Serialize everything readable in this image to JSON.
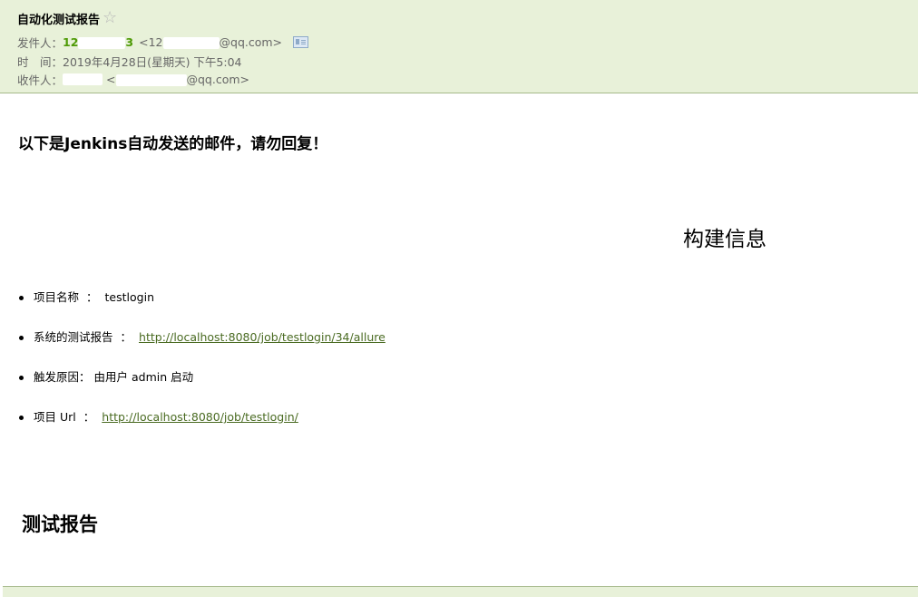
{
  "header": {
    "subject": "自动化测试报告",
    "star_icon": "star-outline-icon",
    "from_label": "发件人：",
    "from_name": "12",
    "from_name_tail": "3",
    "from_addr_open": "<12",
    "from_addr_domain": "@qq.com>",
    "contact_card_icon": "contact-card-icon",
    "time_label": "时　间：",
    "time_value": "2019年4月28日(星期天) 下午5:04",
    "to_label": "收件人：",
    "to_addr_open": "<",
    "to_addr_domain": "@qq.com>"
  },
  "body": {
    "intro": "以下是Jenkins自动发送的邮件，请勿回复！",
    "build_title": "构建信息",
    "items": [
      {
        "label": "项目名称",
        "sep": "：",
        "value": "testlogin"
      },
      {
        "label": "系统的测试报告",
        "sep": "：",
        "link": "http://localhost:8080/job/testlogin/34/allure"
      },
      {
        "label": "触发原因：",
        "value": "由用户 admin 启动"
      },
      {
        "label": "项目 Url",
        "sep": "：",
        "link": "http://localhost:8080/job/testlogin/"
      }
    ],
    "report_title": "测试报告"
  },
  "colors": {
    "header_bg": "#e8f1d9",
    "header_border": "#a6b98a",
    "sender_green": "#4e9a06",
    "link": "#4a6b22"
  }
}
